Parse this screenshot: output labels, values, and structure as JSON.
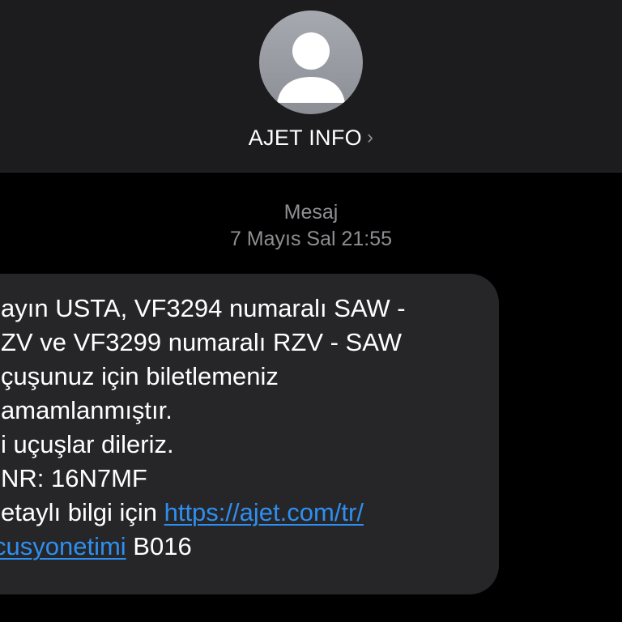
{
  "contact": {
    "name": "AJET INFO",
    "chevron": "›"
  },
  "message_info": {
    "label": "Mesaj",
    "timestamp": "7 Mayıs Sal 21:55"
  },
  "message": {
    "lines": [
      "ayın USTA, VF3294 numaralı SAW -",
      "ZV ve VF3299 numaralı RZV - SAW",
      "çuşunuz için biletlemeniz",
      "amamlanmıştır.",
      "i uçuşlar dileriz.",
      "NR: 16N7MF",
      "etaylı bilgi için "
    ],
    "link_part1": "https://ajet.com/tr/",
    "link_part2": "cusyonetimi",
    "suffix": " B016"
  },
  "colors": {
    "header_bg": "#1c1c1e",
    "bubble_bg": "#262628",
    "link": "#2e8ff0",
    "meta_text": "#8e8e93"
  },
  "icons": {
    "avatar": "person-silhouette-icon",
    "chevron": "chevron-right-icon"
  }
}
